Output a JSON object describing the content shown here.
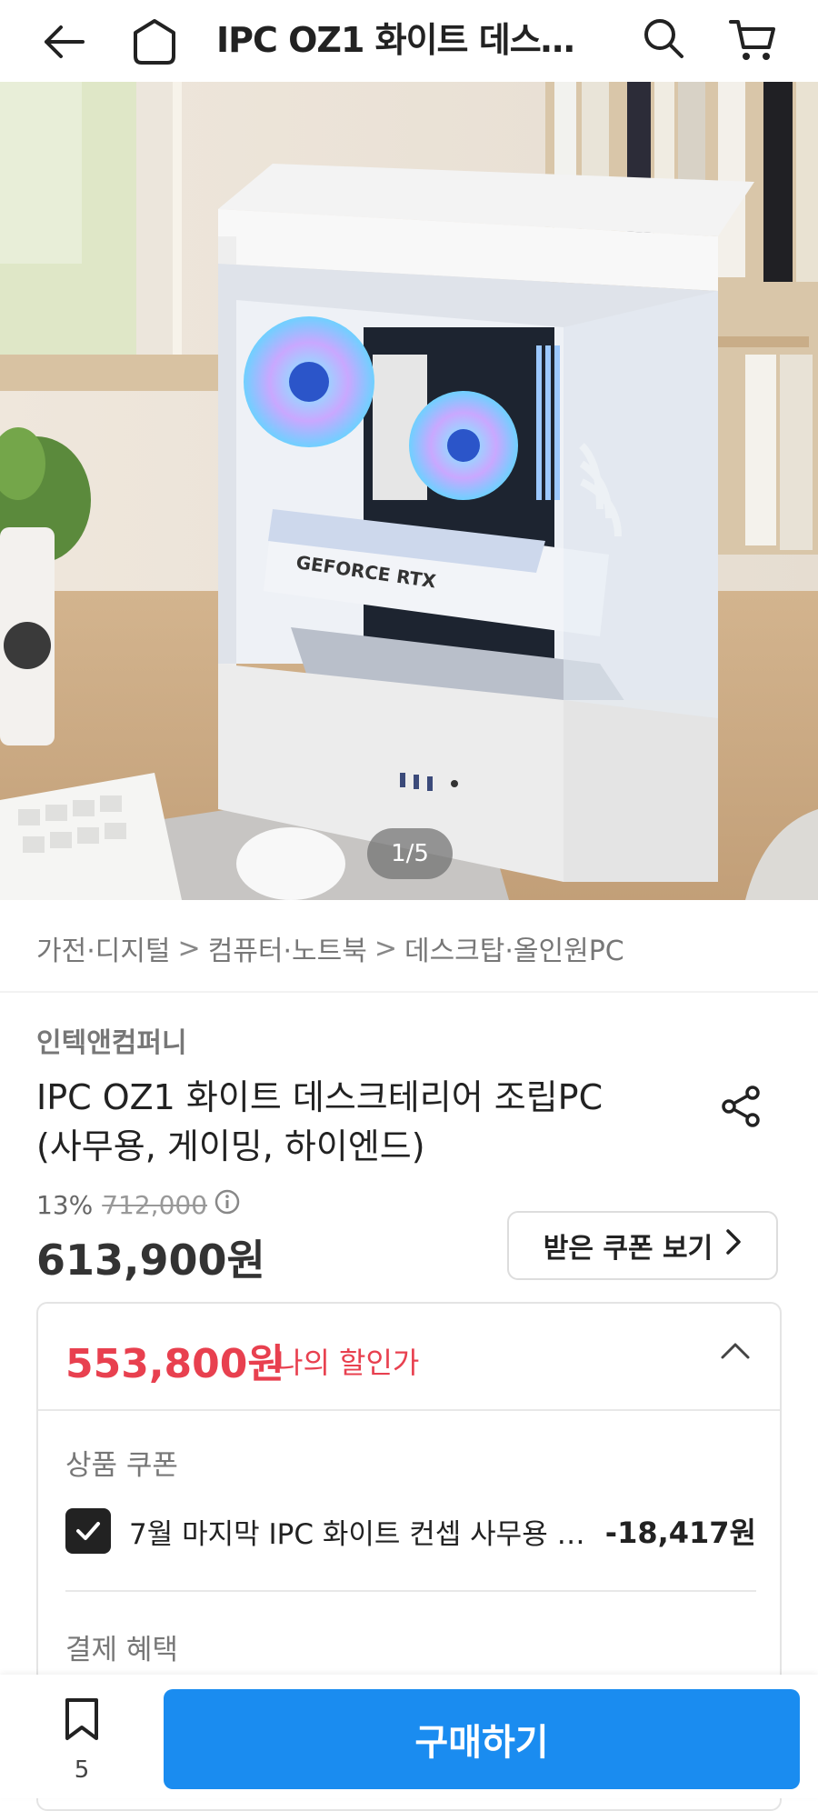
{
  "header": {
    "title": "IPC OZ1 화이트 데스…"
  },
  "hero": {
    "counter": "1/5",
    "gpu_label": "GEFORCE RTX"
  },
  "breadcrumb": {
    "items": [
      "가전·디지털",
      "컴퓨터·노트북",
      "데스크탑·올인원PC"
    ],
    "separator": ">"
  },
  "product": {
    "brand": "인텍앤컴퍼니",
    "name_line1": "IPC OZ1 화이트 데스크테리어 조립PC",
    "name_line2": "(사무용, 게이밍, 하이엔드)",
    "discount_rate": "13%",
    "original_price": "712,000",
    "price": "613,900원",
    "coupon_button": "받은 쿠폰 보기"
  },
  "benefit": {
    "my_price": "553,800원",
    "my_price_label": "나의 할인가",
    "coupon_section_title": "상품 쿠폰",
    "coupon_text": "7월 마지막 IPC 화이트 컨셉 사무용 …",
    "coupon_amount": "-18,417원",
    "coupon_checked": true,
    "payment_section_title": "결제 혜택"
  },
  "bottom": {
    "bookmark_count": "5",
    "buy_label": "구매하기"
  },
  "colors": {
    "accent_red": "#e8404f",
    "buy_blue": "#1a8cf0"
  }
}
